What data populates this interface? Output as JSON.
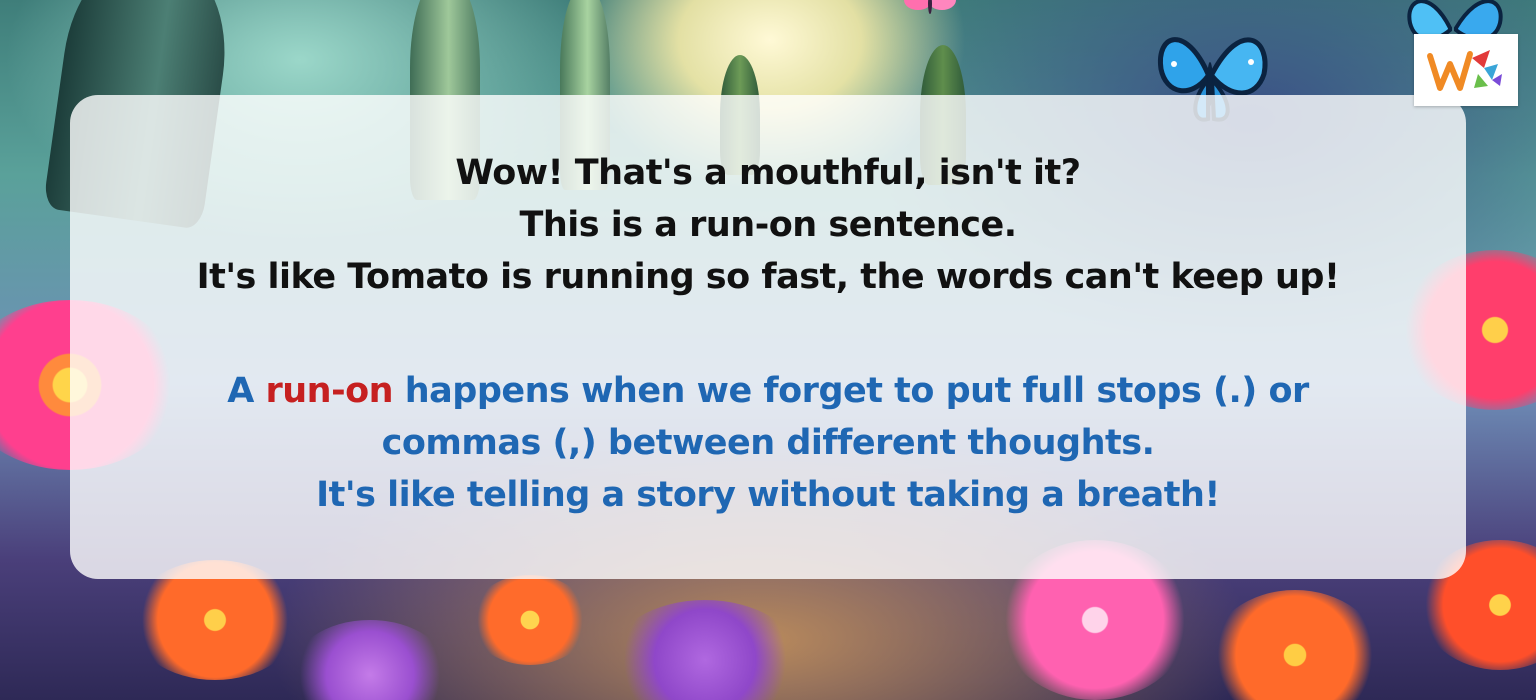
{
  "colors": {
    "intro_text": "#111111",
    "explain_text": "#1f67b3",
    "highlight": "#c62020",
    "card_background": "#ffffff",
    "logo_orange": "#f08a24"
  },
  "intro": {
    "line1": "Wow! That's a mouthful, isn't it?",
    "line2": "This is a run-on sentence.",
    "line3": "It's like Tomato is running so fast, the words can't keep up!"
  },
  "explanation": {
    "line1_start": "A",
    "highlight_term": "run-on",
    "line1_end": "happens when we forget to put full stops (.) or",
    "line2": "commas (,) between different thoughts.",
    "line3": "It's like telling a story without taking a breath!"
  },
  "logo": {
    "icon": "w-logo-icon"
  }
}
